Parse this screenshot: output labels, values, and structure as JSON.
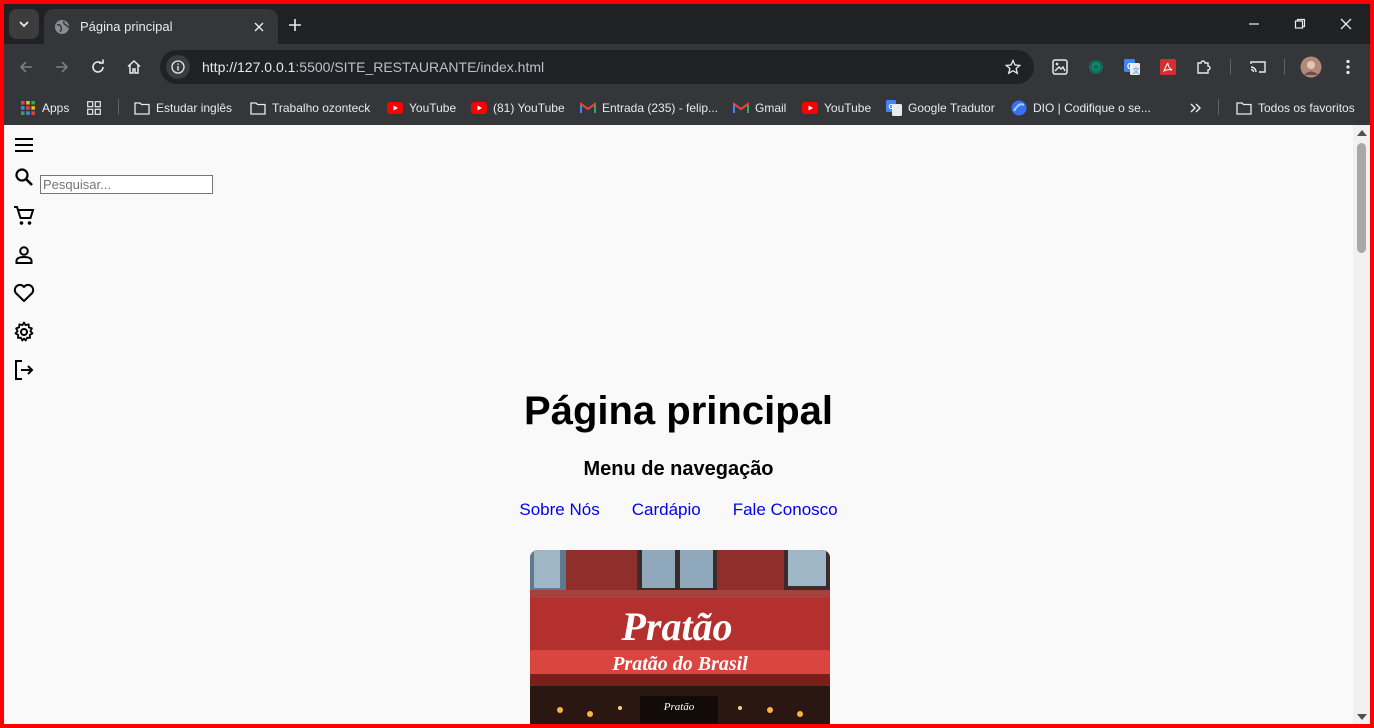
{
  "browser": {
    "tab_title": "Página principal",
    "url_host": "http://127.0.0.1",
    "url_rest": ":5500/SITE_RESTAURANTE/index.html"
  },
  "bookmarks": [
    {
      "label": "Apps",
      "icon": "apps-grid-icon"
    },
    {
      "label": "Estudar inglês",
      "icon": "folder-icon"
    },
    {
      "label": "Trabalho ozonteck",
      "icon": "folder-icon"
    },
    {
      "label": "YouTube",
      "icon": "youtube-icon"
    },
    {
      "label": "(81) YouTube",
      "icon": "youtube-icon"
    },
    {
      "label": "Entrada (235) - felip...",
      "icon": "gmail-icon"
    },
    {
      "label": "Gmail",
      "icon": "gmail-icon"
    },
    {
      "label": "YouTube",
      "icon": "youtube-icon"
    },
    {
      "label": "Google Tradutor",
      "icon": "google-translate-icon"
    },
    {
      "label": "DIO | Codifique o se...",
      "icon": "dio-icon"
    },
    {
      "label": "Todos os favoritos",
      "icon": "folder-icon"
    }
  ],
  "page": {
    "search_placeholder": "Pesquisar...",
    "title": "Página principal",
    "subtitle": "Menu de navegação",
    "nav_links": [
      "Sobre Nós",
      "Cardápio",
      "Fale Conosco"
    ],
    "hero_sign": "Pratão",
    "hero_awning": "Pratão do Brasil",
    "hero_small_sign": "Pratão"
  },
  "colors": {
    "frame_border": "#ff0000",
    "link": "#0000ee",
    "awning": "#c0392b"
  }
}
